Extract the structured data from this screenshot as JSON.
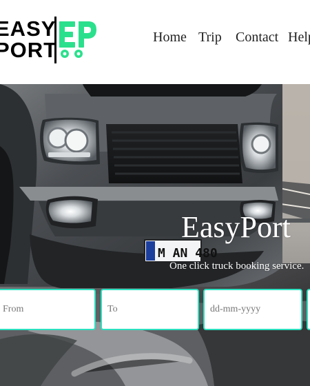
{
  "brand": {
    "line1": "EASY",
    "line2": "PORT",
    "mark_text": "EP",
    "mark_color": "#2be08c",
    "icon": "truck-logo-icon"
  },
  "nav": {
    "items": [
      {
        "label": "Home"
      },
      {
        "label": "Trip"
      },
      {
        "label": "Contact"
      },
      {
        "label": "Help"
      }
    ]
  },
  "hero": {
    "title": "EasyPort",
    "subtitle": "One click truck booking service.",
    "license_plate": "M AN 480",
    "accent_color": "#2be0c0",
    "image_icon": "truck-photo"
  },
  "booking": {
    "from_placeholder": "From",
    "to_placeholder": "To",
    "date_placeholder": "dd-mm-yyyy",
    "extra_placeholder": ""
  }
}
